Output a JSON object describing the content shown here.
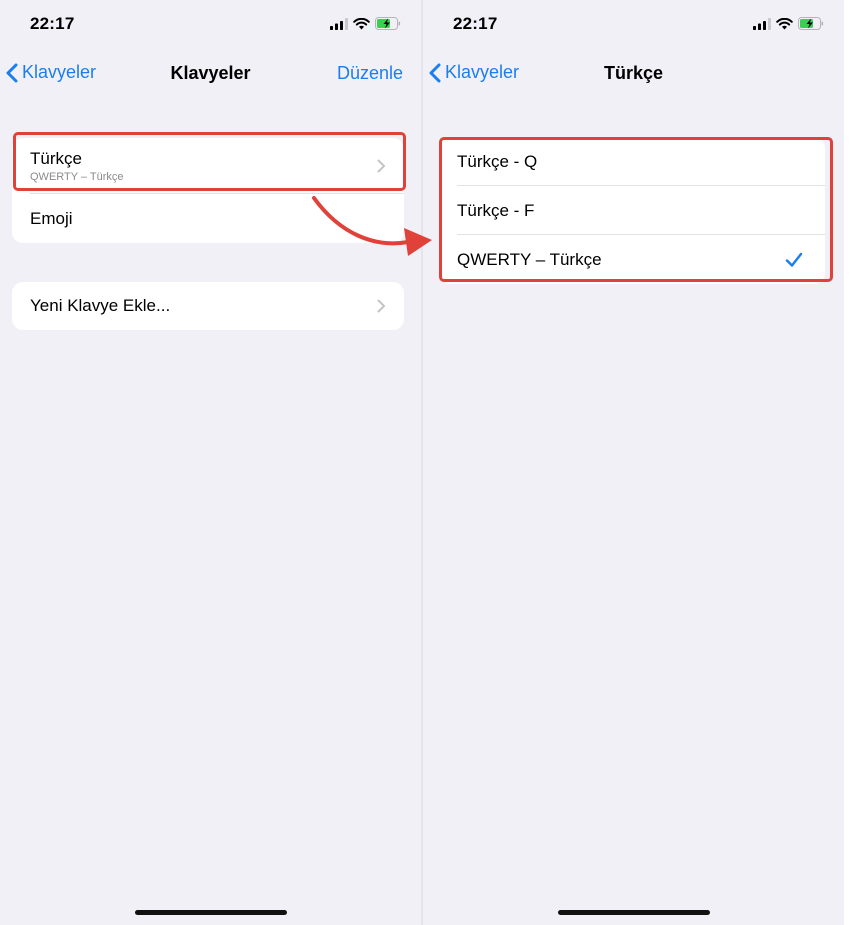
{
  "left_screen": {
    "time": "22:17",
    "nav": {
      "back_label": "Klavyeler",
      "title": "Klavyeler",
      "action_label": "Düzenle"
    },
    "keyboards": [
      {
        "title": "Türkçe",
        "subtitle": "QWERTY – Türkçe"
      },
      {
        "title": "Emoji"
      }
    ],
    "add_keyboard": {
      "title": "Yeni Klavye Ekle..."
    }
  },
  "right_screen": {
    "time": "22:17",
    "nav": {
      "back_label": "Klavyeler",
      "title": "Türkçe"
    },
    "layouts": [
      {
        "title": "Türkçe - Q",
        "selected": false
      },
      {
        "title": "Türkçe - F",
        "selected": false
      },
      {
        "title": "QWERTY – Türkçe",
        "selected": true
      }
    ]
  },
  "colors": {
    "accent": "#1a7ef3",
    "highlight": "#e0423a",
    "background": "#f1f0f6",
    "battery_green": "#3acf4f"
  }
}
